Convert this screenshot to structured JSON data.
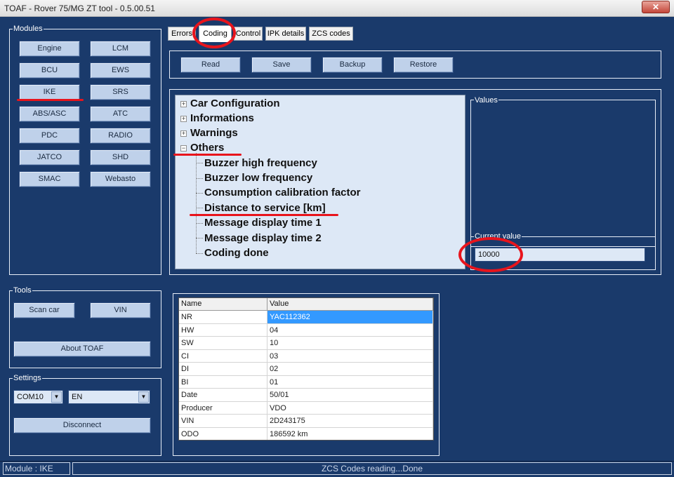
{
  "window": {
    "title": "TOAF - Rover 75/MG ZT tool - 0.5.00.51",
    "close_label": "✕"
  },
  "modules": {
    "title": "Modules",
    "buttons": [
      "Engine",
      "LCM",
      "BCU",
      "EWS",
      "IKE",
      "SRS",
      "ABS/ASC",
      "ATC",
      "PDC",
      "RADIO",
      "JATCO",
      "SHD",
      "SMAC",
      "Webasto"
    ]
  },
  "tools": {
    "title": "Tools",
    "scan_car": "Scan car",
    "vin": "VIN",
    "about": "About TOAF"
  },
  "settings": {
    "title": "Settings",
    "port": "COM10",
    "language": "EN",
    "disconnect": "Disconnect"
  },
  "tabs": [
    "Errors",
    "Coding",
    "Control",
    "IPK details",
    "ZCS codes"
  ],
  "actions": {
    "read": "Read",
    "save": "Save",
    "backup": "Backup",
    "restore": "Restore"
  },
  "tree": {
    "roots": [
      "Car Configuration",
      "Informations",
      "Warnings",
      "Others"
    ],
    "others_children": [
      "Buzzer high frequency",
      "Buzzer low frequency",
      "Consumption calibration factor",
      "Distance to service [km]",
      "Message display time 1",
      "Message display time 2",
      "Coding done"
    ]
  },
  "values_panel": {
    "title": "Values",
    "current_label": "Current value",
    "current_value": "10000"
  },
  "info_table": {
    "headers": [
      "Name",
      "Value"
    ],
    "rows": [
      [
        "NR",
        "YAC112362"
      ],
      [
        "HW",
        "04"
      ],
      [
        "SW",
        "10"
      ],
      [
        "CI",
        "03"
      ],
      [
        "DI",
        "02"
      ],
      [
        "BI",
        "01"
      ],
      [
        "Date",
        "50/01"
      ],
      [
        "Producer",
        "VDO"
      ],
      [
        "VIN",
        "2D243175"
      ],
      [
        "ODO",
        "186592 km"
      ]
    ]
  },
  "status": {
    "module": "Module : IKE",
    "message": "ZCS Codes reading...Done"
  },
  "colors": {
    "background": "#1a3a6b",
    "button": "#bfd1ea",
    "selection": "#3399ff",
    "annotation": "#e8141c"
  }
}
